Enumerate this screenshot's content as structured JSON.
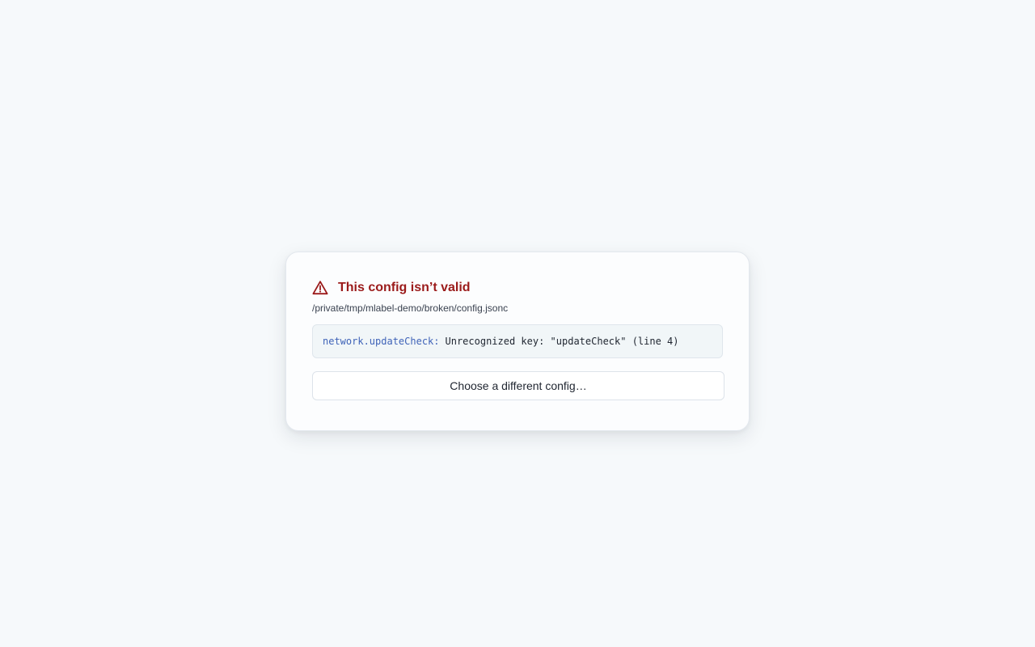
{
  "dialog": {
    "title": "This config isn’t valid",
    "path": "/private/tmp/mlabel-demo/broken/config.jsonc",
    "error": {
      "key": "network.updateCheck:",
      "message": "Unrecognized key: \"updateCheck\" (line 4)"
    },
    "choose_button_label": "Choose a different config…",
    "icon": "warning-triangle-icon"
  },
  "colors": {
    "title": "#9b1b1b",
    "error_key": "#3f63b8",
    "background": "#f6f9fb"
  }
}
